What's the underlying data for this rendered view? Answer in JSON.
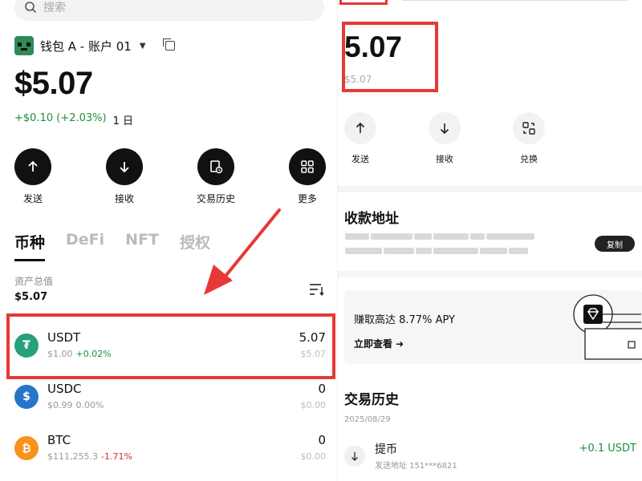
{
  "left": {
    "search": {
      "placeholder": "搜索"
    },
    "wallet": {
      "name": "钱包 A - 账户 01"
    },
    "balance": "$5.07",
    "change": {
      "amount": "+$0.10 (+2.03%)",
      "period": "1 日"
    },
    "actions": [
      {
        "label": "发送",
        "icon": "arrow-up-icon"
      },
      {
        "label": "接收",
        "icon": "arrow-down-icon"
      },
      {
        "label": "交易历史",
        "icon": "history-icon"
      },
      {
        "label": "更多",
        "icon": "grid-icon"
      }
    ],
    "tabs": [
      "币种",
      "DeFi",
      "NFT",
      "授权"
    ],
    "asset_total_label": "资产总值",
    "asset_total": "$5.07",
    "tokens": [
      {
        "symbol": "USDT",
        "price": "$1.00",
        "change": "+0.02%",
        "amount": "5.07",
        "value": "$5.07",
        "color": "#26a17b"
      },
      {
        "symbol": "USDC",
        "price": "$0.99",
        "change": "0.00%",
        "amount": "0",
        "value": "$0.00",
        "color": "#2775ca"
      },
      {
        "symbol": "BTC",
        "price": "$111,255.3",
        "change": "-1.71%",
        "amount": "0",
        "value": "$0.00",
        "color": "#f7931a"
      }
    ]
  },
  "right": {
    "amount": "5.07",
    "amount_usd": "$5.07",
    "actions": [
      {
        "label": "发送",
        "icon": "arrow-up-icon"
      },
      {
        "label": "接收",
        "icon": "arrow-down-icon"
      },
      {
        "label": "兑换",
        "icon": "swap-icon"
      }
    ],
    "receive_title": "收款地址",
    "copy_label": "复制",
    "promo": {
      "title": "赚取高达 8.77% APY",
      "link": "立即查看 ➜"
    },
    "history_title": "交易历史",
    "date": "2025/08/29",
    "tx": {
      "name": "提币",
      "sub": "发送地址 151***6821",
      "amount": "+0.1 USDT"
    }
  },
  "colors": {
    "accent_red": "#e53935",
    "positive": "#1e8e3e",
    "negative": "#d93025"
  }
}
